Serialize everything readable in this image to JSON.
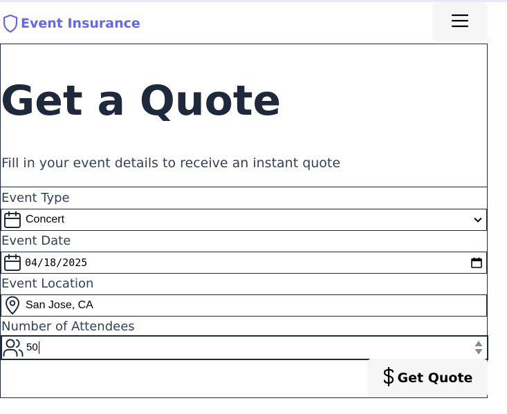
{
  "header": {
    "brand_name": "Event Insurance",
    "brand_icon": "shield-icon",
    "brand_color": "#6366f1",
    "menu_icon": "hamburger-menu-icon"
  },
  "main": {
    "title": "Get a Quote",
    "subtitle": "Fill in your event details to receive an instant quote"
  },
  "form": {
    "event_type": {
      "label": "Event Type",
      "value": "Concert",
      "icon": "calendar-icon"
    },
    "event_date": {
      "label": "Event Date",
      "value": "04/18/2025",
      "icon": "calendar-icon"
    },
    "event_location": {
      "label": "Event Location",
      "value": "San Jose, CA",
      "icon": "map-pin-icon"
    },
    "attendees": {
      "label": "Number of Attendees",
      "value": "50",
      "icon": "users-icon"
    },
    "submit_label": "Get Quote",
    "submit_icon": "dollar-sign-icon"
  }
}
